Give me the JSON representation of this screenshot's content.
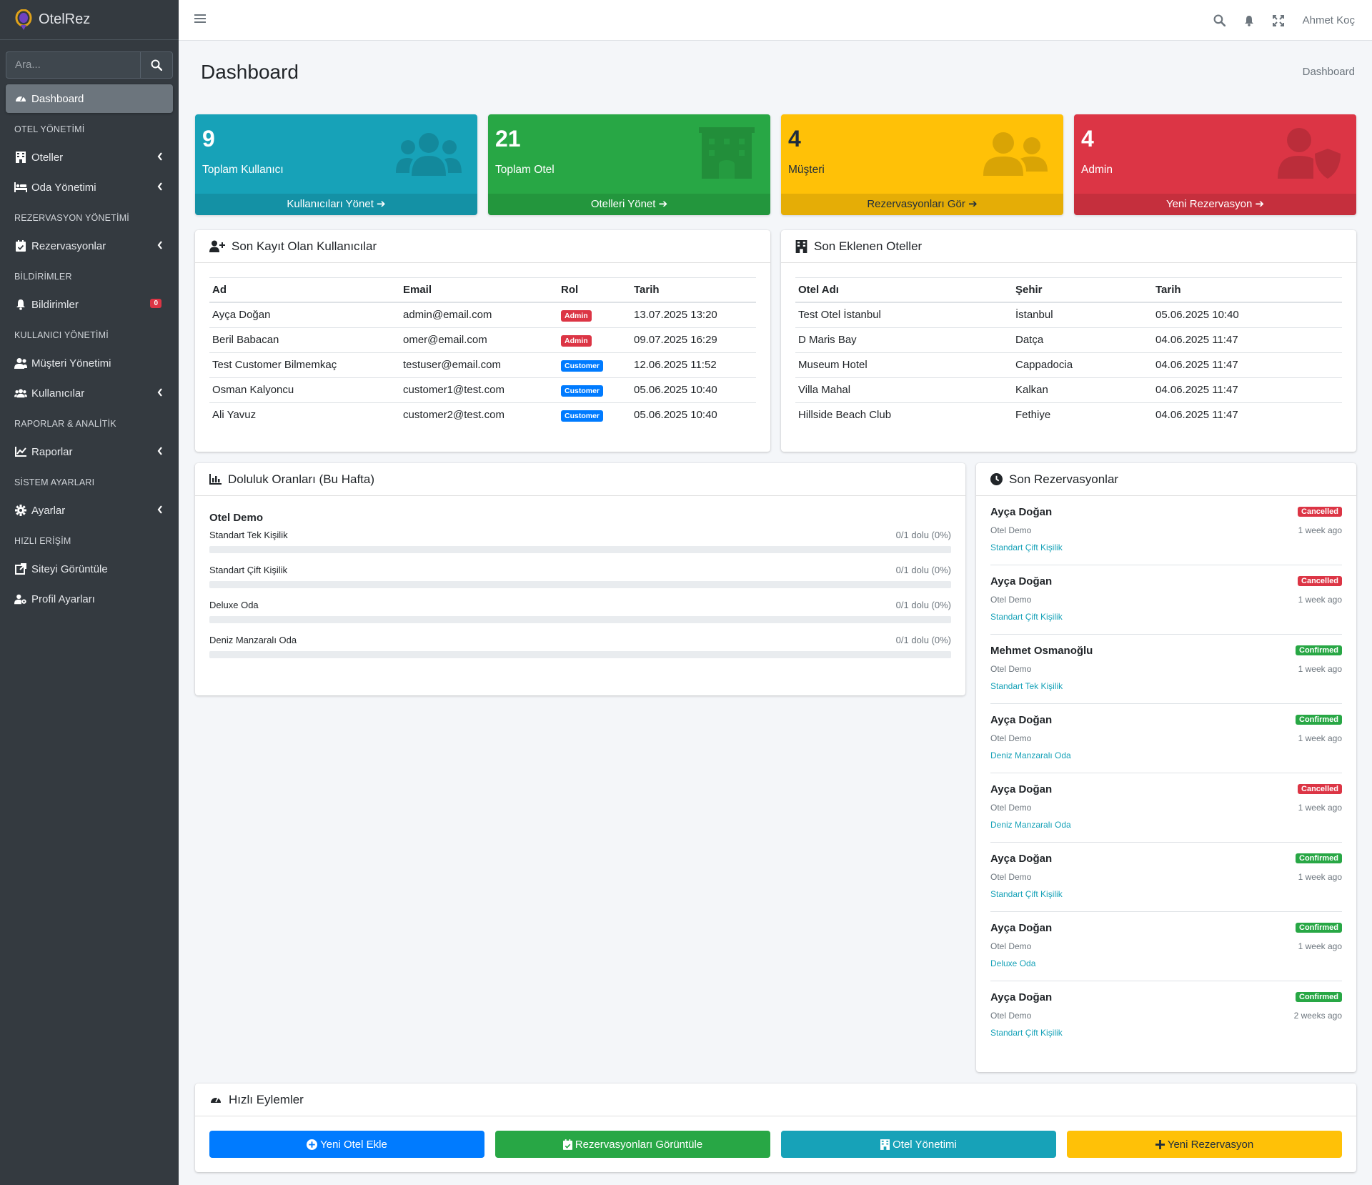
{
  "brand": {
    "name": "OtelRez"
  },
  "sidebar": {
    "search_placeholder": "Ara...",
    "items": {
      "dashboard": "Dashboard",
      "header_otel": "OTEL YÖNETİMİ",
      "oteller": "Oteller",
      "oda": "Oda Yönetimi",
      "header_rez": "REZERVASYON YÖNETİMİ",
      "rezervasyonlar": "Rezervasyonlar",
      "header_bildirim": "BİLDİRİMLER",
      "bildirimler": "Bildirimler",
      "bildirim_count": "0",
      "header_kullanici": "KULLANICI YÖNETİMİ",
      "musteri": "Müşteri Yönetimi",
      "kullanicilar": "Kullanıcılar",
      "header_rapor": "RAPORLAR & ANALİTİK",
      "raporlar": "Raporlar",
      "header_sistem": "SİSTEM AYARLARI",
      "ayarlar": "Ayarlar",
      "header_hizli": "HIZLI ERİŞİM",
      "siteyi": "Siteyi Görüntüle",
      "profil": "Profil Ayarları"
    }
  },
  "topbar": {
    "user": "Ahmet Koç"
  },
  "page": {
    "title": "Dashboard",
    "breadcrumb": "Dashboard"
  },
  "stats": [
    {
      "value": "9",
      "label": "Toplam Kullanıcı",
      "link": "Kullanıcıları Yönet",
      "color": "#17a2b8"
    },
    {
      "value": "21",
      "label": "Toplam Otel",
      "link": "Otelleri Yönet",
      "color": "#28a745"
    },
    {
      "value": "4",
      "label": "Müşteri",
      "link": "Rezervasyonları Gör",
      "color": "#ffc107"
    },
    {
      "value": "4",
      "label": "Admin",
      "link": "Yeni Rezervasyon",
      "color": "#dc3545"
    }
  ],
  "users_card": {
    "title": "Son Kayıt Olan Kullanıcılar",
    "headers": [
      "Ad",
      "Email",
      "Rol",
      "Tarih"
    ],
    "rows": [
      {
        "name": "Ayça Doğan",
        "email": "admin@email.com",
        "role": "Admin",
        "date": "13.07.2025 13:20"
      },
      {
        "name": "Beril Babacan",
        "email": "omer@email.com",
        "role": "Admin",
        "date": "09.07.2025 16:29"
      },
      {
        "name": "Test Customer Bilmemkaç",
        "email": "testuser@email.com",
        "role": "Customer",
        "date": "12.06.2025 11:52"
      },
      {
        "name": "Osman Kalyoncu",
        "email": "customer1@test.com",
        "role": "Customer",
        "date": "05.06.2025 10:40"
      },
      {
        "name": "Ali Yavuz",
        "email": "customer2@test.com",
        "role": "Customer",
        "date": "05.06.2025 10:40"
      }
    ]
  },
  "hotels_card": {
    "title": "Son Eklenen Oteller",
    "headers": [
      "Otel Adı",
      "Şehir",
      "Tarih"
    ],
    "rows": [
      {
        "name": "Test Otel İstanbul",
        "city": "İstanbul",
        "date": "05.06.2025 10:40"
      },
      {
        "name": "D Maris Bay",
        "city": "Datça",
        "date": "04.06.2025 11:47"
      },
      {
        "name": "Museum Hotel",
        "city": "Cappadocia",
        "date": "04.06.2025 11:47"
      },
      {
        "name": "Villa Mahal",
        "city": "Kalkan",
        "date": "04.06.2025 11:47"
      },
      {
        "name": "Hillside Beach Club",
        "city": "Fethiye",
        "date": "04.06.2025 11:47"
      }
    ]
  },
  "occupancy": {
    "title": "Doluluk Oranları (Bu Hafta)",
    "hotel": "Otel Demo",
    "rooms": [
      {
        "name": "Standart Tek Kişilik",
        "value": "0/1 dolu (0%)",
        "fraction": 0
      },
      {
        "name": "Standart Çift Kişilik",
        "value": "0/1 dolu (0%)",
        "fraction": 0
      },
      {
        "name": "Deluxe Oda",
        "value": "0/1 dolu (0%)",
        "fraction": 0
      },
      {
        "name": "Deniz Manzaralı Oda",
        "value": "0/1 dolu (0%)",
        "fraction": 0
      }
    ]
  },
  "reservations": {
    "title": "Son Rezervasyonlar",
    "items": [
      {
        "name": "Ayça Doğan",
        "hotel": "Otel Demo",
        "room": "Standart Çift Kişilik",
        "status": "Cancelled",
        "ago": "1 week ago"
      },
      {
        "name": "Ayça Doğan",
        "hotel": "Otel Demo",
        "room": "Standart Çift Kişilik",
        "status": "Cancelled",
        "ago": "1 week ago"
      },
      {
        "name": "Mehmet Osmanoğlu",
        "hotel": "Otel Demo",
        "room": "Standart Tek Kişilik",
        "status": "Confirmed",
        "ago": "1 week ago"
      },
      {
        "name": "Ayça Doğan",
        "hotel": "Otel Demo",
        "room": "Deniz Manzaralı Oda",
        "status": "Confirmed",
        "ago": "1 week ago"
      },
      {
        "name": "Ayça Doğan",
        "hotel": "Otel Demo",
        "room": "Deniz Manzaralı Oda",
        "status": "Cancelled",
        "ago": "1 week ago"
      },
      {
        "name": "Ayça Doğan",
        "hotel": "Otel Demo",
        "room": "Standart Çift Kişilik",
        "status": "Confirmed",
        "ago": "1 week ago"
      },
      {
        "name": "Ayça Doğan",
        "hotel": "Otel Demo",
        "room": "Deluxe Oda",
        "status": "Confirmed",
        "ago": "1 week ago"
      },
      {
        "name": "Ayça Doğan",
        "hotel": "Otel Demo",
        "room": "Standart Çift Kişilik",
        "status": "Confirmed",
        "ago": "2 weeks ago"
      }
    ]
  },
  "quick_actions": {
    "title": "Hızlı Eylemler",
    "buttons": [
      {
        "label": "Yeni Otel Ekle",
        "color": "#007bff",
        "icon": "plus-circle-icon"
      },
      {
        "label": "Rezervasyonları Görüntüle",
        "color": "#28a745",
        "icon": "calendar-check-icon"
      },
      {
        "label": "Otel Yönetimi",
        "color": "#17a2b8",
        "icon": "building-icon"
      },
      {
        "label": "Yeni Rezervasyon",
        "color": "#ffc107",
        "icon": "plus-icon"
      }
    ]
  }
}
